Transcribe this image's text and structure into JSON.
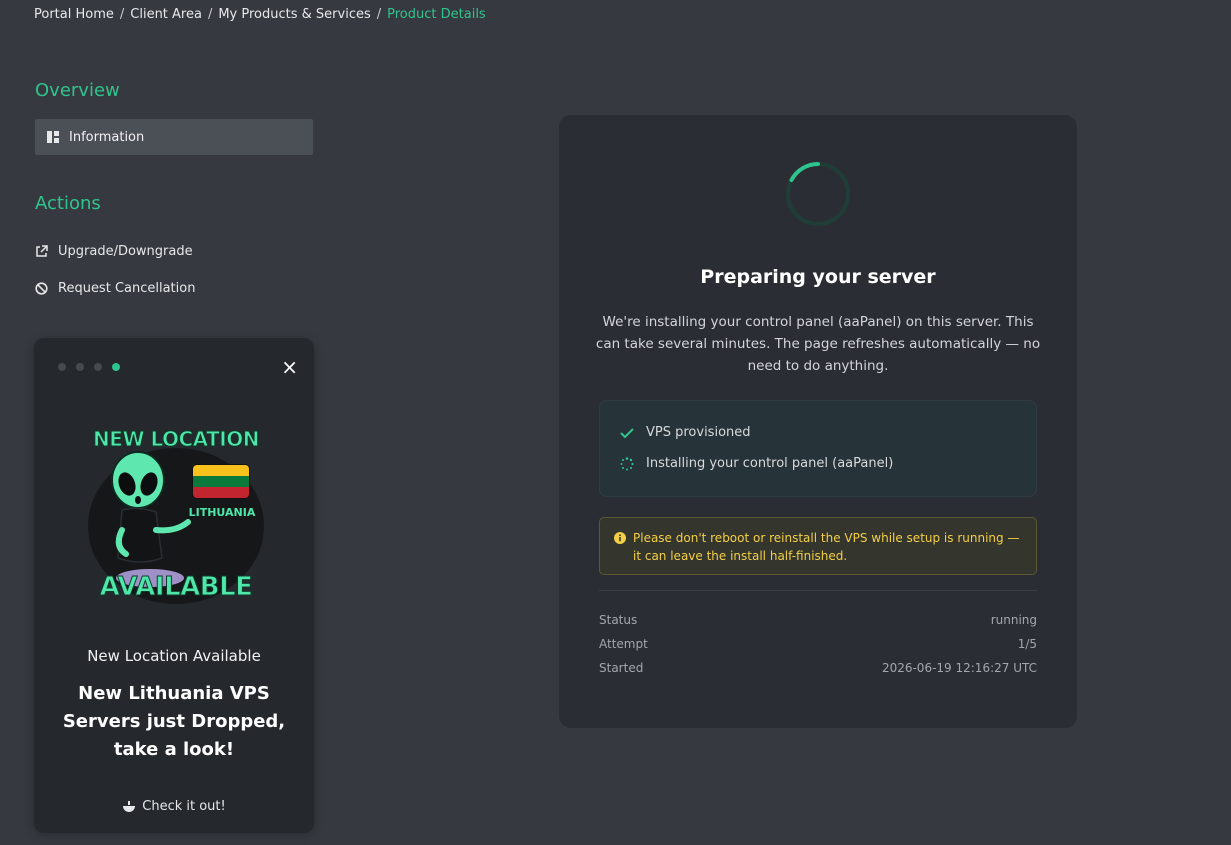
{
  "breadcrumb": {
    "items": [
      "Portal Home",
      "Client Area",
      "My Products & Services"
    ],
    "active": "Product Details",
    "separator": "/"
  },
  "sidebar": {
    "overview_title": "Overview",
    "information_label": "Information",
    "actions_title": "Actions",
    "upgrade_label": "Upgrade/Downgrade",
    "cancel_label": "Request Cancellation"
  },
  "promo": {
    "image_text_top": "NEW LOCATION",
    "image_text_country": "LITHUANIA",
    "image_text_bottom": "AVAILABLE",
    "subtitle": "New Location Available",
    "headline": "New Lithuania VPS Servers just Dropped, take a look!",
    "cta_label": "Check it out!",
    "close_symbol": "×",
    "dots_total": 4,
    "dots_active": 4
  },
  "setup": {
    "title": "Preparing your server",
    "description": "We're installing your control panel (aaPanel) on this server. This can take several minutes. The page refreshes automatically — no need to do anything.",
    "steps": [
      {
        "label": "VPS provisioned",
        "state": "done",
        "icon": "check-icon"
      },
      {
        "label": "Installing your control panel (aaPanel)",
        "state": "in-progress",
        "icon": "loading-dots-icon"
      }
    ],
    "warning": "Please don't reboot or reinstall the VPS while setup is running — it can leave the install half-finished.",
    "details": {
      "status_label": "Status",
      "status_value": "running",
      "attempt_label": "Attempt",
      "attempt_value": "1/5",
      "started_label": "Started",
      "started_value": "2026-06-19 12:16:27 UTC"
    }
  },
  "colors": {
    "accent": "#2fc48d",
    "background": "#363a40",
    "card": "#2a2e34",
    "warning_text": "#f4cf46"
  }
}
